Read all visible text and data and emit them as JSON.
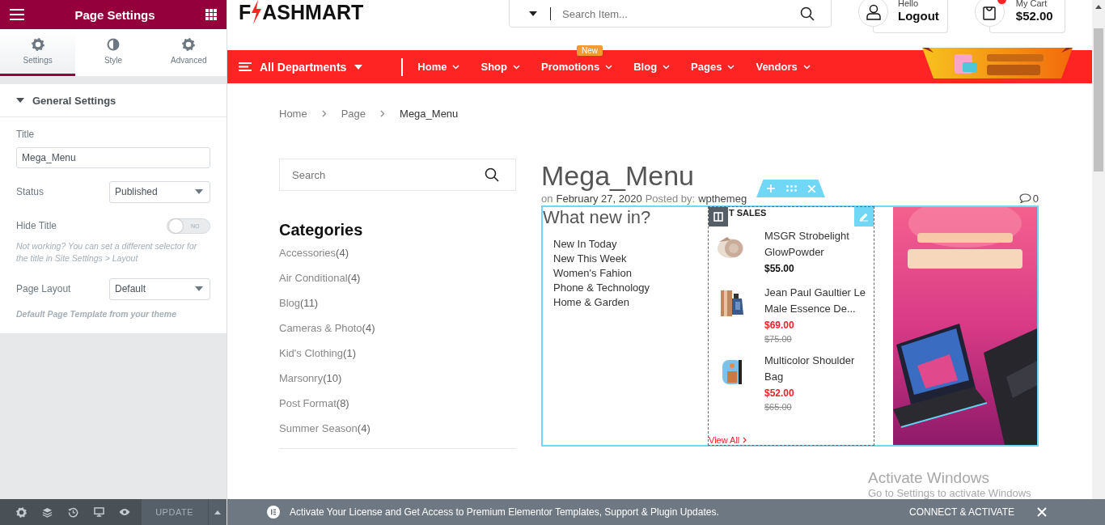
{
  "editor_panel": {
    "title": "Page Settings",
    "tabs": [
      {
        "label": "Settings",
        "selected": true
      },
      {
        "label": "Style",
        "selected": false
      },
      {
        "label": "Advanced",
        "selected": false
      }
    ],
    "section": {
      "title": "General Settings",
      "expanded": true
    },
    "fields": [
      {
        "kind": "text",
        "label": "Title",
        "value": "Mega_Menu"
      },
      {
        "kind": "select",
        "label": "Status",
        "value": "Published"
      },
      {
        "kind": "toggle",
        "label": "Hide Title",
        "on": false,
        "toggle_text": "NO",
        "note": "Not working? You can set a different selector for the title in Site Settings > Layout"
      },
      {
        "kind": "select",
        "label": "Page Layout",
        "value": "Default",
        "note": "Default Page Template from your theme"
      }
    ],
    "update_button": "UPDATE"
  },
  "header": {
    "logo": {
      "before": "F",
      "after": "ASHMART"
    },
    "search": {
      "placeholder": "Search Item..."
    },
    "account": {
      "greeting": "Hello",
      "action": "Logout"
    },
    "cart": {
      "label": "My Cart",
      "total": "$52.00"
    }
  },
  "nav": {
    "departments": "All Departments",
    "items": [
      {
        "label": "Home"
      },
      {
        "label": "Shop"
      },
      {
        "label": "Promotions",
        "badge": "New"
      },
      {
        "label": "Blog"
      },
      {
        "label": "Pages"
      },
      {
        "label": "Vendors"
      }
    ]
  },
  "breadcrumb": [
    "Home",
    "Page",
    "Mega_Menu"
  ],
  "sidebar": {
    "search_placeholder": "Search",
    "categories_title": "Categories",
    "categories": [
      {
        "name": "Accessories",
        "count": "(4)"
      },
      {
        "name": "Air Conditional",
        "count": "(4)"
      },
      {
        "name": "Blog",
        "count": "(11)"
      },
      {
        "name": "Cameras & Photo",
        "count": "(4)"
      },
      {
        "name": "Kid's Clothing",
        "count": "(1)"
      },
      {
        "name": "Marsonry",
        "count": "(10)"
      },
      {
        "name": "Post Format",
        "count": "(8)"
      },
      {
        "name": "Summer Season",
        "count": "(4)"
      }
    ]
  },
  "post": {
    "title": "Mega_Menu",
    "date_prefix": "on",
    "date": "February 27, 2020",
    "author_prefix": "Posted by:",
    "author": "wpthemeg",
    "comments": "0",
    "mega_menu": {
      "heading": "What new in?",
      "links": [
        "New In Today",
        "New This Week",
        "Women's Fahion",
        "Phone & Technology",
        "Home & Garden"
      ],
      "sales_heading": "T SALES",
      "products": [
        {
          "name": "MSGR Strobelight GlowPowder",
          "price": "$55.00",
          "on_sale": false
        },
        {
          "name": "Jean Paul Gaultier Le Male Essence De...",
          "price": "$69.00",
          "old_price": "$75.00",
          "on_sale": true
        },
        {
          "name": "Multicolor Shoulder Bag",
          "price": "$52.00",
          "old_price": "$65.00",
          "on_sale": true
        }
      ],
      "view_all": "View All"
    }
  },
  "notice": {
    "text": "Activate Your License and Get Access to Premium Elementor Templates, Support & Plugin Updates.",
    "action": "CONNECT & ACTIVATE"
  },
  "os_overlay": {
    "title": "Activate Windows",
    "subtitle": "Go to Settings to activate Windows"
  }
}
